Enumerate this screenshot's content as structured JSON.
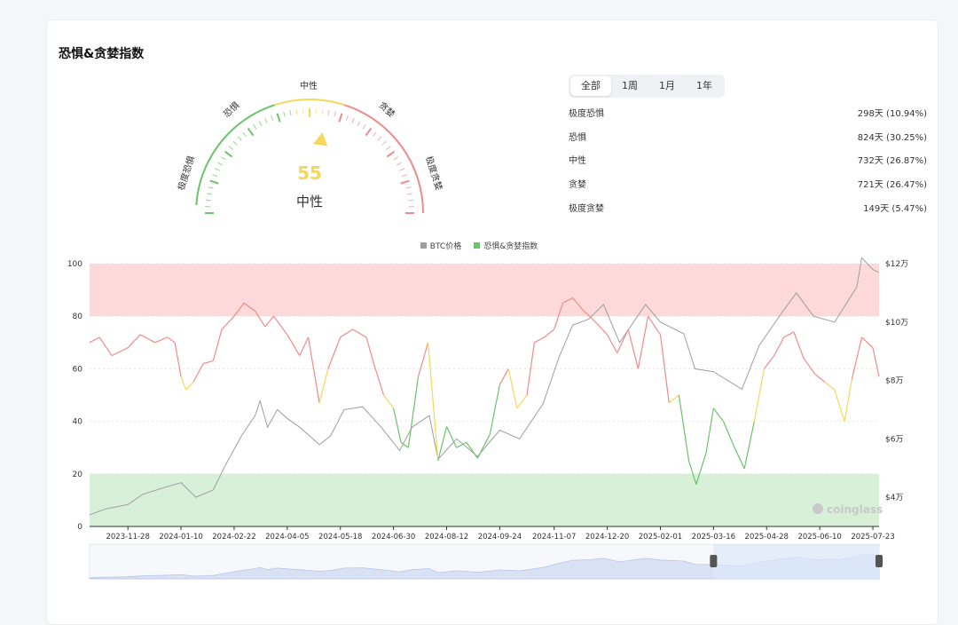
{
  "title": "恐惧&贪婪指数",
  "gauge": {
    "value": "55",
    "label": "中性",
    "labels": {
      "extreme_fear": "极度恐惧",
      "fear": "恐惧",
      "neutral": "中性",
      "greed": "贪婪",
      "extreme_greed": "极度贪婪"
    }
  },
  "tabs": [
    "全部",
    "1周",
    "1月",
    "1年"
  ],
  "stats": [
    {
      "label": "极度恐惧",
      "value": "298天 (10.94%)"
    },
    {
      "label": "恐惧",
      "value": "824天 (30.25%)"
    },
    {
      "label": "中性",
      "value": "732天 (26.87%)"
    },
    {
      "label": "贪婪",
      "value": "721天 (26.47%)"
    },
    {
      "label": "极度贪婪",
      "value": "149天 (5.47%)"
    }
  ],
  "legend": {
    "btc": "BTC价格",
    "index": "恐惧&贪婪指数"
  },
  "colors": {
    "fear": "#6cc36c",
    "neutral": "#f5d75a",
    "greed": "#f08b8b",
    "btc_line": "#9e9e9e",
    "greed_zone": "#fdd9d9",
    "fear_zone": "#d8efd8",
    "brush": "#dde8fb"
  },
  "watermark": "coinglass",
  "chart_data": {
    "type": "line",
    "x": [
      "2023-11-28",
      "2024-01-10",
      "2024-02-22",
      "2024-04-05",
      "2024-05-18",
      "2024-06-30",
      "2024-08-12",
      "2024-09-24",
      "2024-11-07",
      "2024-12-20",
      "2025-02-01",
      "2025-03-16",
      "2025-04-28",
      "2025-06-10",
      "2025-07-23"
    ],
    "x_range": [
      "2023-10-28",
      "2025-07-28"
    ],
    "y_left_ticks": [
      "0",
      "20",
      "40",
      "60",
      "80",
      "100"
    ],
    "y_left_range": [
      0,
      100
    ],
    "y_right_ticks": [
      "$4万",
      "$6万",
      "$8万",
      "$10万",
      "$12万"
    ],
    "y_right_range": [
      30000,
      120000
    ],
    "zones": [
      {
        "from": 80,
        "to": 100,
        "name": "greed"
      },
      {
        "from": 0,
        "to": 20,
        "name": "fear"
      }
    ],
    "series": [
      {
        "name": "恐惧&贪婪指数",
        "axis": "left",
        "points": [
          [
            "2023-10-28",
            70
          ],
          [
            "2023-11-05",
            72
          ],
          [
            "2023-11-15",
            65
          ],
          [
            "2023-11-28",
            68
          ],
          [
            "2023-12-08",
            73
          ],
          [
            "2023-12-20",
            70
          ],
          [
            "2023-12-30",
            72
          ],
          [
            "2024-01-05",
            70
          ],
          [
            "2024-01-10",
            57
          ],
          [
            "2024-01-14",
            52
          ],
          [
            "2024-01-20",
            55
          ],
          [
            "2024-01-28",
            62
          ],
          [
            "2024-02-05",
            63
          ],
          [
            "2024-02-12",
            75
          ],
          [
            "2024-02-22",
            80
          ],
          [
            "2024-03-01",
            85
          ],
          [
            "2024-03-10",
            82
          ],
          [
            "2024-03-18",
            76
          ],
          [
            "2024-03-25",
            80
          ],
          [
            "2024-04-05",
            73
          ],
          [
            "2024-04-15",
            65
          ],
          [
            "2024-04-22",
            72
          ],
          [
            "2024-05-01",
            47
          ],
          [
            "2024-05-08",
            60
          ],
          [
            "2024-05-18",
            72
          ],
          [
            "2024-05-28",
            75
          ],
          [
            "2024-06-08",
            72
          ],
          [
            "2024-06-14",
            62
          ],
          [
            "2024-06-22",
            50
          ],
          [
            "2024-06-30",
            45
          ],
          [
            "2024-07-06",
            32
          ],
          [
            "2024-07-12",
            30
          ],
          [
            "2024-07-20",
            57
          ],
          [
            "2024-07-28",
            70
          ],
          [
            "2024-08-05",
            25
          ],
          [
            "2024-08-12",
            38
          ],
          [
            "2024-08-20",
            30
          ],
          [
            "2024-08-28",
            32
          ],
          [
            "2024-09-06",
            26
          ],
          [
            "2024-09-16",
            35
          ],
          [
            "2024-09-24",
            54
          ],
          [
            "2024-10-01",
            60
          ],
          [
            "2024-10-08",
            45
          ],
          [
            "2024-10-16",
            50
          ],
          [
            "2024-10-22",
            70
          ],
          [
            "2024-10-30",
            72
          ],
          [
            "2024-11-07",
            75
          ],
          [
            "2024-11-14",
            85
          ],
          [
            "2024-11-22",
            87
          ],
          [
            "2024-12-01",
            82
          ],
          [
            "2024-12-10",
            78
          ],
          [
            "2024-12-20",
            73
          ],
          [
            "2024-12-28",
            66
          ],
          [
            "2025-01-06",
            75
          ],
          [
            "2025-01-14",
            60
          ],
          [
            "2025-01-22",
            80
          ],
          [
            "2025-02-01",
            73
          ],
          [
            "2025-02-08",
            47
          ],
          [
            "2025-02-16",
            50
          ],
          [
            "2025-02-24",
            25
          ],
          [
            "2025-03-02",
            16
          ],
          [
            "2025-03-10",
            28
          ],
          [
            "2025-03-16",
            45
          ],
          [
            "2025-03-24",
            40
          ],
          [
            "2025-04-02",
            30
          ],
          [
            "2025-04-10",
            22
          ],
          [
            "2025-04-18",
            40
          ],
          [
            "2025-04-26",
            60
          ],
          [
            "2025-05-04",
            65
          ],
          [
            "2025-05-12",
            72
          ],
          [
            "2025-05-20",
            74
          ],
          [
            "2025-05-28",
            64
          ],
          [
            "2025-06-06",
            58
          ],
          [
            "2025-06-14",
            55
          ],
          [
            "2025-06-22",
            52
          ],
          [
            "2025-06-30",
            40
          ],
          [
            "2025-07-06",
            56
          ],
          [
            "2025-07-14",
            72
          ],
          [
            "2025-07-23",
            68
          ],
          [
            "2025-07-28",
            57
          ]
        ]
      },
      {
        "name": "BTC价格",
        "axis": "right",
        "points": [
          [
            "2023-10-28",
            34000
          ],
          [
            "2023-11-10",
            36000
          ],
          [
            "2023-11-28",
            37500
          ],
          [
            "2023-12-10",
            41000
          ],
          [
            "2023-12-25",
            43000
          ],
          [
            "2024-01-10",
            45000
          ],
          [
            "2024-01-22",
            40000
          ],
          [
            "2024-02-05",
            42500
          ],
          [
            "2024-02-15",
            51000
          ],
          [
            "2024-02-28",
            61000
          ],
          [
            "2024-03-10",
            68000
          ],
          [
            "2024-03-14",
            73000
          ],
          [
            "2024-03-20",
            64000
          ],
          [
            "2024-03-28",
            70000
          ],
          [
            "2024-04-05",
            67000
          ],
          [
            "2024-04-15",
            64000
          ],
          [
            "2024-05-01",
            58000
          ],
          [
            "2024-05-10",
            61000
          ],
          [
            "2024-05-21",
            70000
          ],
          [
            "2024-06-05",
            71000
          ],
          [
            "2024-06-20",
            64000
          ],
          [
            "2024-07-05",
            56000
          ],
          [
            "2024-07-15",
            64000
          ],
          [
            "2024-07-29",
            68000
          ],
          [
            "2024-08-05",
            53000
          ],
          [
            "2024-08-20",
            60000
          ],
          [
            "2024-09-06",
            54000
          ],
          [
            "2024-09-24",
            63000
          ],
          [
            "2024-10-10",
            60000
          ],
          [
            "2024-10-29",
            72000
          ],
          [
            "2024-11-11",
            88000
          ],
          [
            "2024-11-22",
            99000
          ],
          [
            "2024-12-05",
            101000
          ],
          [
            "2024-12-17",
            106000
          ],
          [
            "2024-12-30",
            93000
          ],
          [
            "2025-01-20",
            106000
          ],
          [
            "2025-02-01",
            100000
          ],
          [
            "2025-02-20",
            96000
          ],
          [
            "2025-03-01",
            84000
          ],
          [
            "2025-03-16",
            83000
          ],
          [
            "2025-04-08",
            77000
          ],
          [
            "2025-04-22",
            92000
          ],
          [
            "2025-05-10",
            103000
          ],
          [
            "2025-05-22",
            110000
          ],
          [
            "2025-06-05",
            102000
          ],
          [
            "2025-06-22",
            100000
          ],
          [
            "2025-07-10",
            112000
          ],
          [
            "2025-07-14",
            122000
          ],
          [
            "2025-07-23",
            118000
          ],
          [
            "2025-07-28",
            117000
          ]
        ]
      }
    ],
    "brush_range": [
      "2025-03-16",
      "2025-07-28"
    ]
  }
}
